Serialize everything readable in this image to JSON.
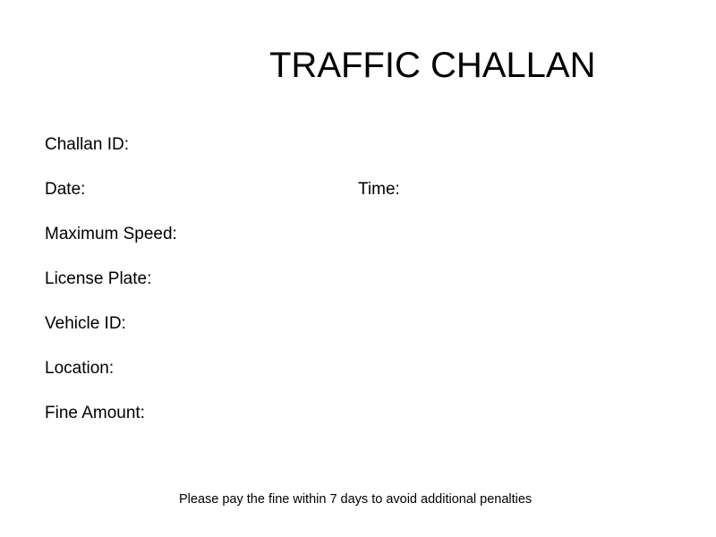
{
  "document": {
    "title": "TRAFFIC CHALLAN",
    "fields": {
      "challan_id_label": "Challan ID:",
      "date_label": "Date:",
      "time_label": "Time:",
      "max_speed_label": "Maximum Speed:",
      "license_plate_label": "License Plate:",
      "vehicle_id_label": "Vehicle ID:",
      "location_label": "Location:",
      "fine_amount_label": "Fine Amount:"
    },
    "footer_note": "Please pay the fine within 7 days to avoid additional penalties"
  }
}
